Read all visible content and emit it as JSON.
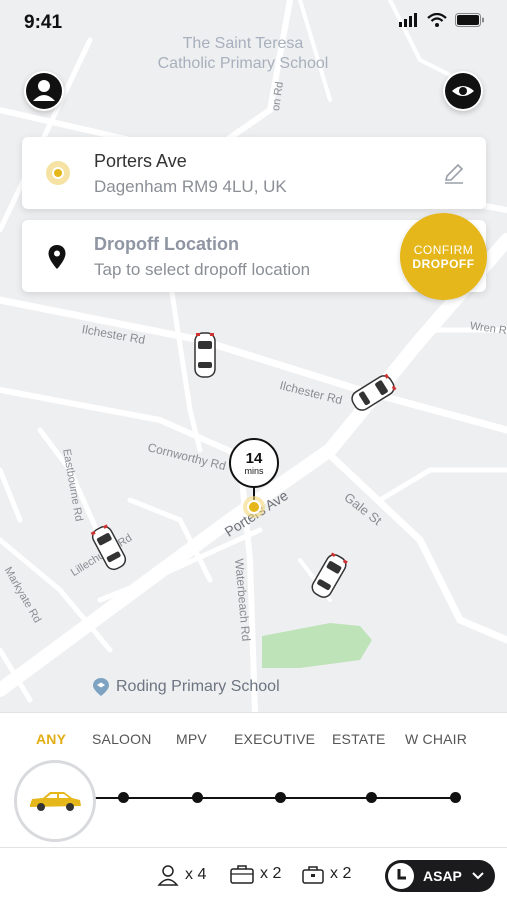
{
  "status_bar": {
    "time": "9:41"
  },
  "pickup": {
    "title": "Porters Ave",
    "subtitle": "Dagenham RM9 4LU, UK"
  },
  "dropoff": {
    "title": "Dropoff Location",
    "subtitle": "Tap to select dropoff location"
  },
  "confirm": {
    "line1": "CONFIRM",
    "line2": "DROPOFF"
  },
  "eta": {
    "value": "14",
    "unit": "mins"
  },
  "map_labels": {
    "school_top_line1": "The Saint Teresa",
    "school_top_line2": "Catholic Primary School",
    "school_bottom": "Roding Primary School",
    "ilchester_rd_1": "Ilchester Rd",
    "ilchester_rd_2": "Ilchester Rd",
    "cornworthy_rd": "Cornworthy Rd",
    "porters_ave": "Porters Ave",
    "gale_st": "Gale St",
    "waterbeach_rd": "Waterbeach Rd",
    "wren_rd": "Wren Rd",
    "eastbourne_rd": "Eastbourne Rd",
    "lillechurch_rd": "Lillechurch Rd",
    "markyate_rd": "Markyate Rd",
    "top_rd": "on Rd"
  },
  "vehicle_types": [
    "ANY",
    "SALOON",
    "MPV",
    "EXECUTIVE",
    "ESTATE",
    "W CHAIR"
  ],
  "selected_vehicle": "ANY",
  "capacity": {
    "passengers": "x 4",
    "luggage": "x 2",
    "hand_luggage": "x 2"
  },
  "time_button": {
    "label": "ASAP"
  },
  "colors": {
    "accent": "#E6B71A",
    "dark": "#1B1B1D",
    "map_bg": "#EEEFF1",
    "park": "#BFE3B8"
  }
}
